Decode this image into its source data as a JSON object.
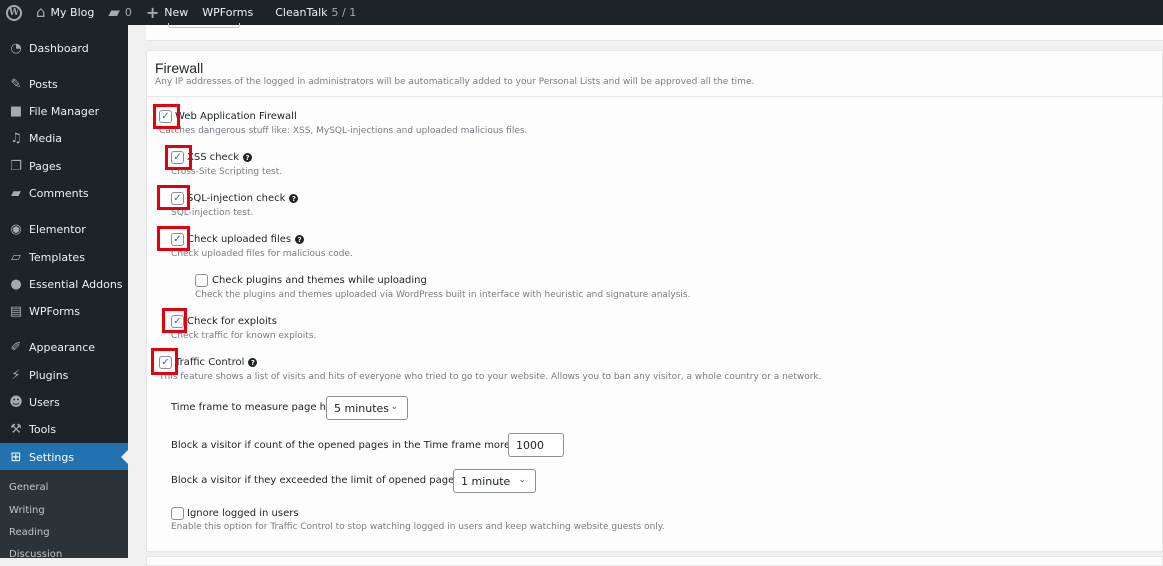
{
  "adminbar": {
    "site_name": "My Blog",
    "comments_count": "0",
    "new_label": "New",
    "wpforms_label": "WPForms",
    "cleantalk_label": "CleanTalk",
    "cleantalk_count": "5 / 1"
  },
  "sidebar": {
    "items": [
      {
        "label": "Dashboard",
        "icon": "dashboard-icon"
      },
      {
        "label": "Posts",
        "icon": "pin-icon"
      },
      {
        "label": "File Manager",
        "icon": "folder-icon"
      },
      {
        "label": "Media",
        "icon": "media-icon"
      },
      {
        "label": "Pages",
        "icon": "pages-icon"
      },
      {
        "label": "Comments",
        "icon": "comment-icon"
      },
      {
        "label": "Elementor",
        "icon": "elementor-icon"
      },
      {
        "label": "Templates",
        "icon": "folder-open-icon"
      },
      {
        "label": "Essential Addons",
        "icon": "ea-icon"
      },
      {
        "label": "WPForms",
        "icon": "form-icon"
      },
      {
        "label": "Appearance",
        "icon": "brush-icon"
      },
      {
        "label": "Plugins",
        "icon": "plug-icon"
      },
      {
        "label": "Users",
        "icon": "user-icon"
      },
      {
        "label": "Tools",
        "icon": "wrench-icon"
      },
      {
        "label": "Settings",
        "icon": "settings-icon",
        "active": true
      }
    ],
    "submenu": [
      "General",
      "Writing",
      "Reading",
      "Discussion"
    ]
  },
  "firewall": {
    "title": "Firewall",
    "subtitle": "Any IP addresses of the logged in administrators will be automatically added to your Personal Lists and will be approved all the time.",
    "options": {
      "waf": {
        "label": "Web Application Firewall",
        "desc": "Catches dangerous stuff like: XSS, MySQL-injections and uploaded malicious files.",
        "checked": true
      },
      "xss": {
        "label": "XSS check",
        "desc": "Cross-Site Scripting test.",
        "checked": true
      },
      "sql": {
        "label": "SQL-injection check",
        "desc": "SQL-injection test.",
        "checked": true
      },
      "upload": {
        "label": "Check uploaded files",
        "desc": "Check uploaded files for malicious code.",
        "checked": true
      },
      "plugins": {
        "label": "Check plugins and themes while uploading",
        "desc": "Check the plugins and themes uploaded via WordPress built in interface with heuristic and signature analysis.",
        "checked": false
      },
      "exploits": {
        "label": "Check for exploits",
        "desc": "Check traffic for known exploits.",
        "checked": true
      },
      "traffic": {
        "label": "Traffic Control",
        "desc": "This feature shows a list of visits and hits of everyone who tried to go to your website. Allows you to ban any visitor, a whole country or a network.",
        "checked": true
      },
      "ignore_logged": {
        "label": "Ignore logged in users",
        "desc": "Enable this option for Traffic Control to stop watching logged in users and keep watching website guests only.",
        "checked": false
      }
    },
    "timeframe": {
      "label": "Time frame to measure page hits",
      "value": "5 minutes"
    },
    "block_count": {
      "label": "Block a visitor if count of the opened pages in the Time frame more than",
      "value": "1000"
    },
    "block_period": {
      "label": "Block a visitor if they exceeded the limit of opened pages for",
      "value": "1 minute"
    }
  }
}
